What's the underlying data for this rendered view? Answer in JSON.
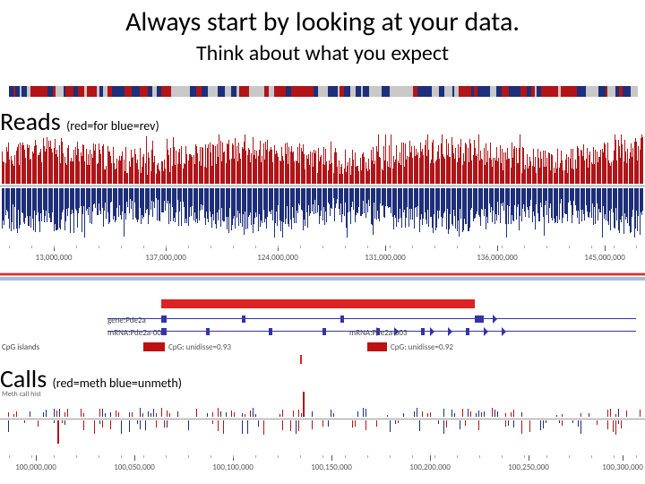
{
  "title": "Always start by looking at your data.",
  "subtitle": "Think about what you expect",
  "reads_label": "Reads",
  "reads_annot": "(red=for blue=rev)",
  "calls_label": "Calls",
  "calls_annot": "(red=meth blue=unmeth)",
  "header1_caption": "",
  "header2_caption": "",
  "gene": {
    "gene_label": "gene:Pde2a",
    "mrna1": "mRNA:Pde2a-001",
    "mrna2": "mRNA:Pde2a-003",
    "cpg1": "CpG: unidisse=0.93",
    "cpg2": "CpG: unidisse=0.92",
    "islands_label": "CpG islands"
  },
  "calls_row_label": "Meth call hist",
  "axis1": {
    "t0": "13,000,000",
    "t1": "137,000,000",
    "t2": "124,000,000",
    "t3": "131,000,000",
    "t4": "136,000,000",
    "t5": "145,000,000"
  },
  "axis2": {
    "t0": "100,000,000",
    "t1": "100,050,000",
    "t2": "100,100,000",
    "t3": "100,150,000",
    "t4": "100,200,000",
    "t5": "100,250,000",
    "t6": "100,300,000"
  },
  "colors": {
    "fwd": "#b11518",
    "rev": "#1d2f7a",
    "red_accent": "#d22",
    "blue_accent": "#2e52a3"
  }
}
